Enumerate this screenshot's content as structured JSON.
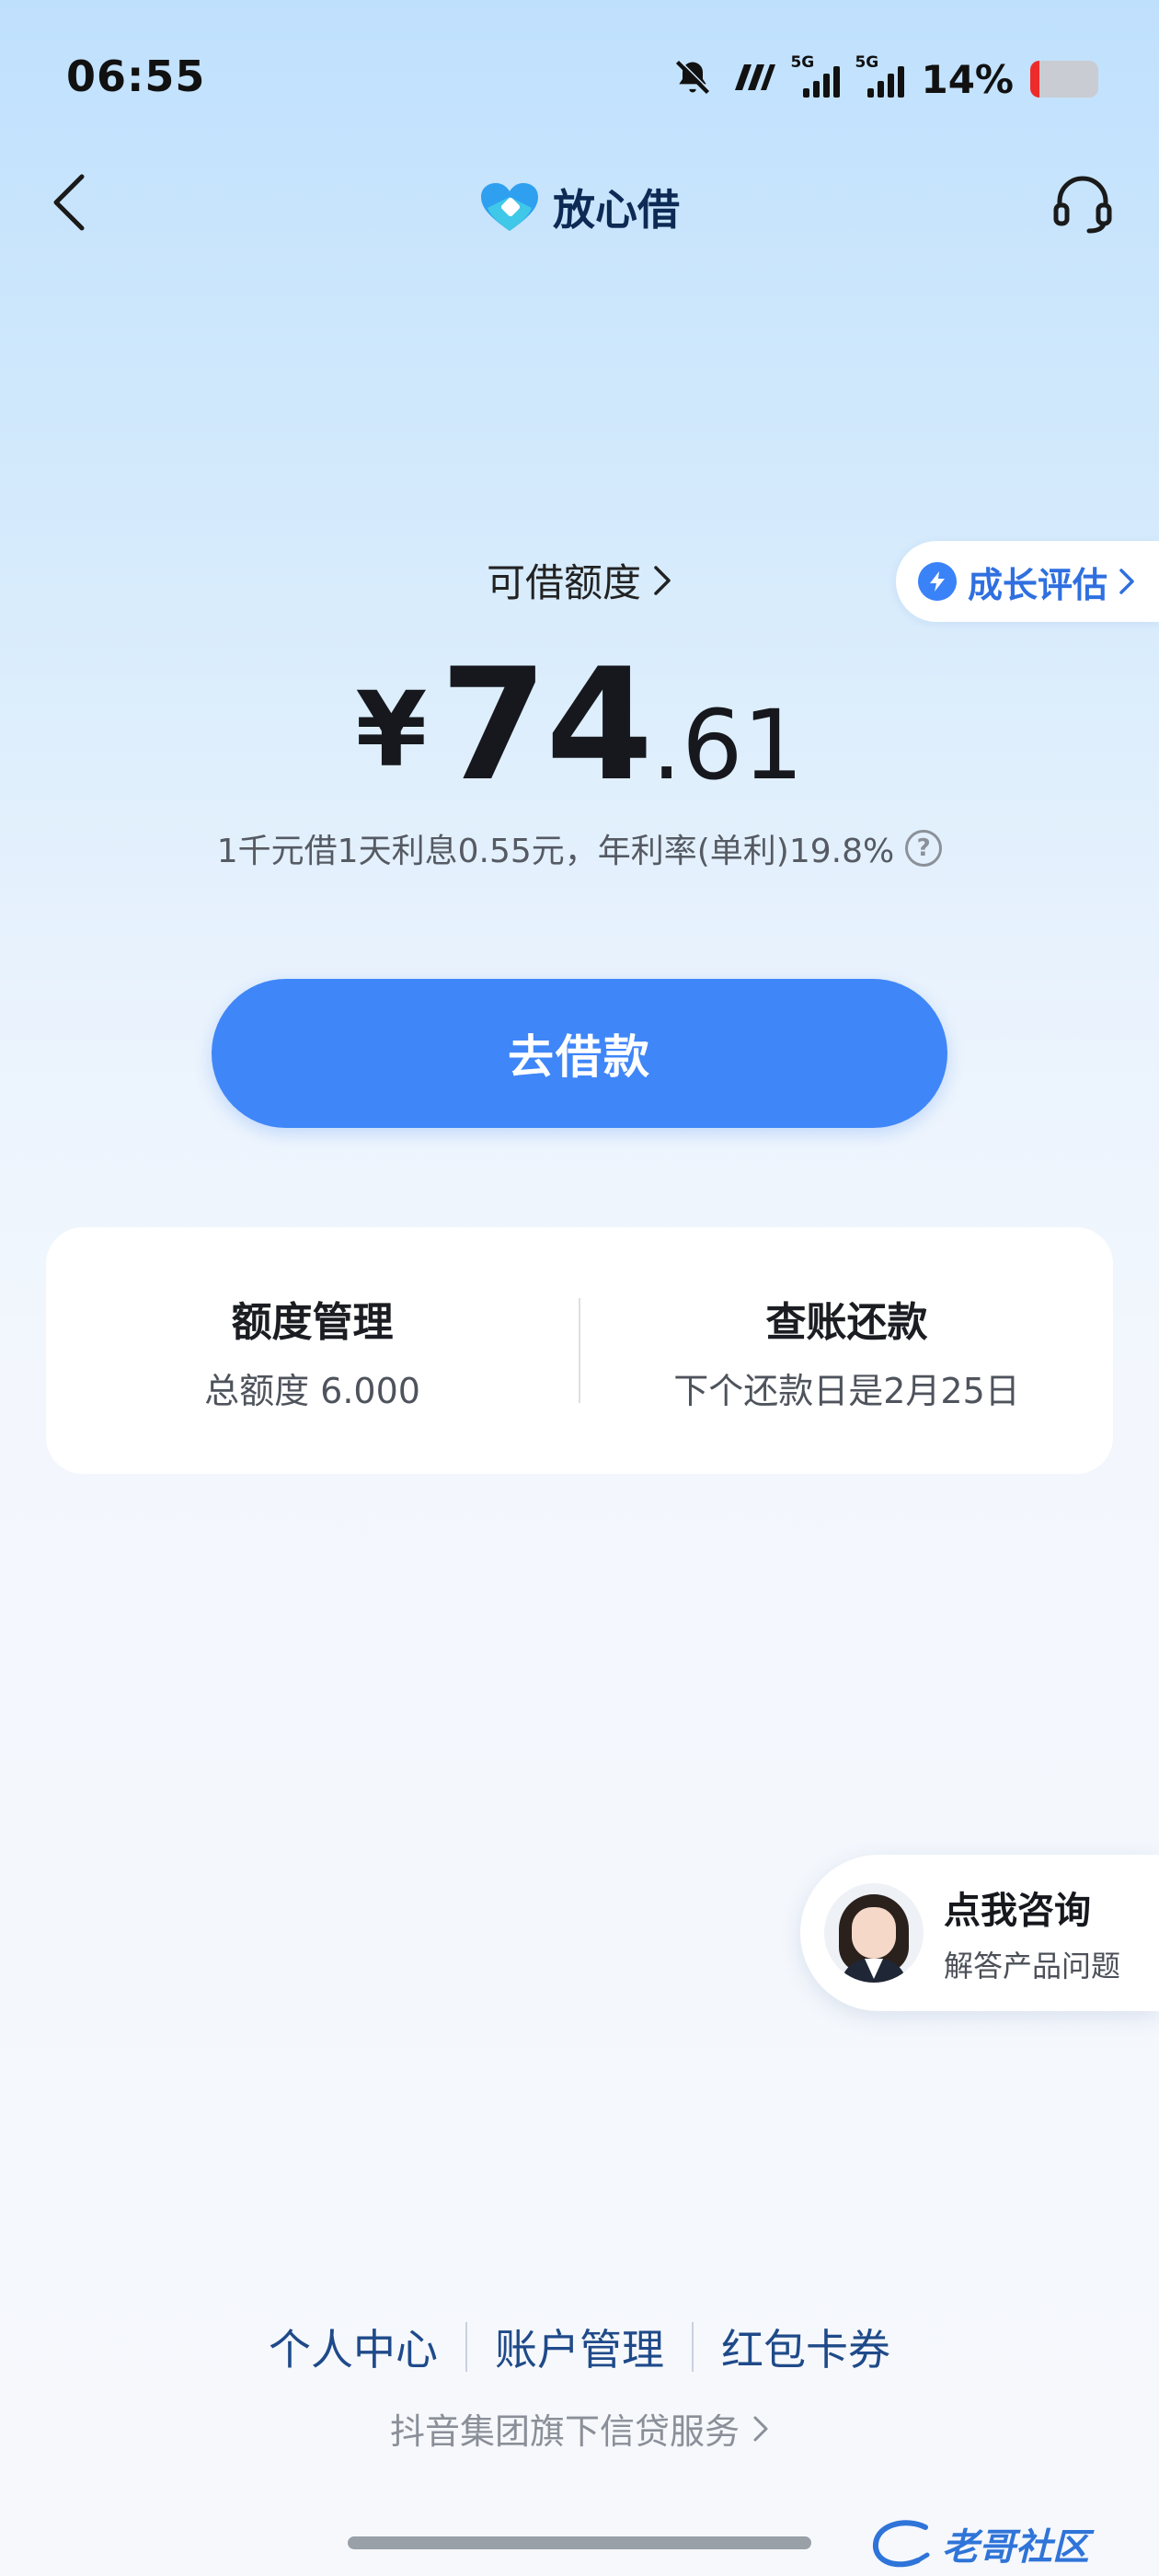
{
  "status_bar": {
    "time": "06:55",
    "signal_label_1": "5G",
    "signal_label_2": "5G",
    "battery_percent": "14%"
  },
  "nav": {
    "app_name": "放心借",
    "back_icon": "chevron-left-icon",
    "service_icon": "headset-icon"
  },
  "credit": {
    "label": "可借额度",
    "currency": "¥",
    "amount_integer": "74",
    "amount_decimal": ".61",
    "rate_text": "1千元借1天利息0.55元，年利率(单利)19.8%",
    "help_glyph": "?"
  },
  "growth_pill": {
    "label": "成长评估"
  },
  "borrow_button": {
    "label": "去借款"
  },
  "card": {
    "left": {
      "title": "额度管理",
      "sub": "总额度 6.000"
    },
    "right": {
      "title": "查账还款",
      "sub": "下个还款日是2月25日"
    }
  },
  "consult": {
    "title": "点我咨询",
    "sub": "解答产品问题"
  },
  "footer": {
    "links": [
      "个人中心",
      "账户管理",
      "红包卡券"
    ],
    "note": "抖音集团旗下信贷服务"
  },
  "watermark": {
    "text": "老哥社区"
  },
  "colors": {
    "accent": "#3f86f8",
    "link": "#1f4a89",
    "battery_low": "#ee2b2b"
  }
}
